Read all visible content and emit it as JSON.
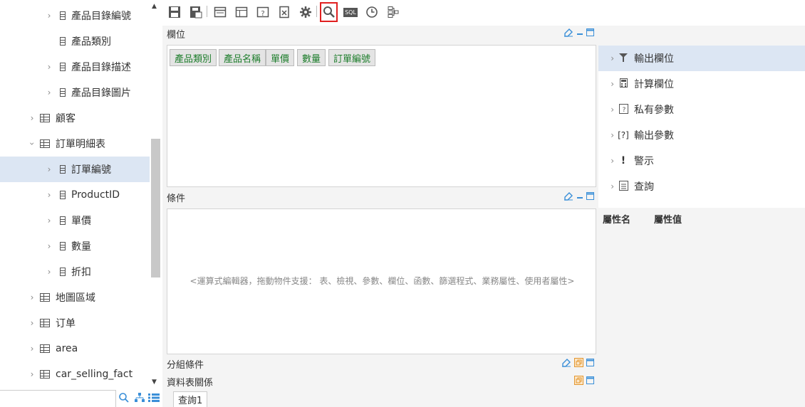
{
  "tree": {
    "items": [
      {
        "label": "產品目錄編號",
        "level": 2,
        "type": "field",
        "expanded": false
      },
      {
        "label": "產品類別",
        "level": 2,
        "type": "field",
        "no_chevron": true
      },
      {
        "label": "產品目錄描述",
        "level": 2,
        "type": "field"
      },
      {
        "label": "產品目錄圖片",
        "level": 2,
        "type": "field"
      },
      {
        "label": "顧客",
        "level": 1,
        "type": "table"
      },
      {
        "label": "訂單明細表",
        "level": 1,
        "type": "table",
        "expanded": true
      },
      {
        "label": "訂單編號",
        "level": 2,
        "type": "field",
        "selected": true
      },
      {
        "label": "ProductID",
        "level": 2,
        "type": "field"
      },
      {
        "label": "單價",
        "level": 2,
        "type": "field"
      },
      {
        "label": "數量",
        "level": 2,
        "type": "field"
      },
      {
        "label": "折扣",
        "level": 2,
        "type": "field"
      },
      {
        "label": "地圖區域",
        "level": 1,
        "type": "table"
      },
      {
        "label": "订单",
        "level": 1,
        "type": "table"
      },
      {
        "label": "area",
        "level": 1,
        "type": "table"
      },
      {
        "label": "car_selling_fact",
        "level": 1,
        "type": "table"
      }
    ]
  },
  "toolbar": {
    "buttons": [
      "save-icon",
      "save-as-icon",
      "layout-icon",
      "table-icon",
      "parameter-icon",
      "export-icon",
      "settings-icon",
      "search-icon",
      "sql-icon",
      "clock-icon",
      "hierarchy-icon"
    ],
    "sql_label": "SQL",
    "active": "search-icon"
  },
  "sections": {
    "fields": {
      "title": "欄位",
      "chips": [
        "產品類別",
        "產品名稱",
        "單價",
        "數量",
        "訂單編號"
      ]
    },
    "conditions": {
      "title": "條件",
      "hint": "<運算式編輯器，拖動物件支援： 表、檢視、參數、欄位、函數、篩選程式、業務屬性、使用者屬性>"
    },
    "group": {
      "title": "分組條件"
    },
    "relations": {
      "title": "資料表關係"
    }
  },
  "tabs": {
    "query": "查詢1"
  },
  "right_panel": {
    "items": [
      {
        "label": "輸出欄位",
        "icon": "filter-icon",
        "selected": true
      },
      {
        "label": "計算欄位",
        "icon": "calculator-icon"
      },
      {
        "label": "私有參數",
        "icon": "private-param-icon"
      },
      {
        "label": "輸出參數",
        "icon": "output-param-icon",
        "glyph": "[?]"
      },
      {
        "label": "警示",
        "icon": "alert-icon",
        "glyph": "!"
      },
      {
        "label": "查詢",
        "icon": "query-icon"
      }
    ],
    "property_name": "屬性名",
    "property_value": "屬性值"
  },
  "colors": {
    "selected_bg": "#dce6f3",
    "chip_text": "#1d7d2b",
    "active_border": "#e02020",
    "accent": "#3a8fd8",
    "window_bg": "#f4f4f4"
  }
}
